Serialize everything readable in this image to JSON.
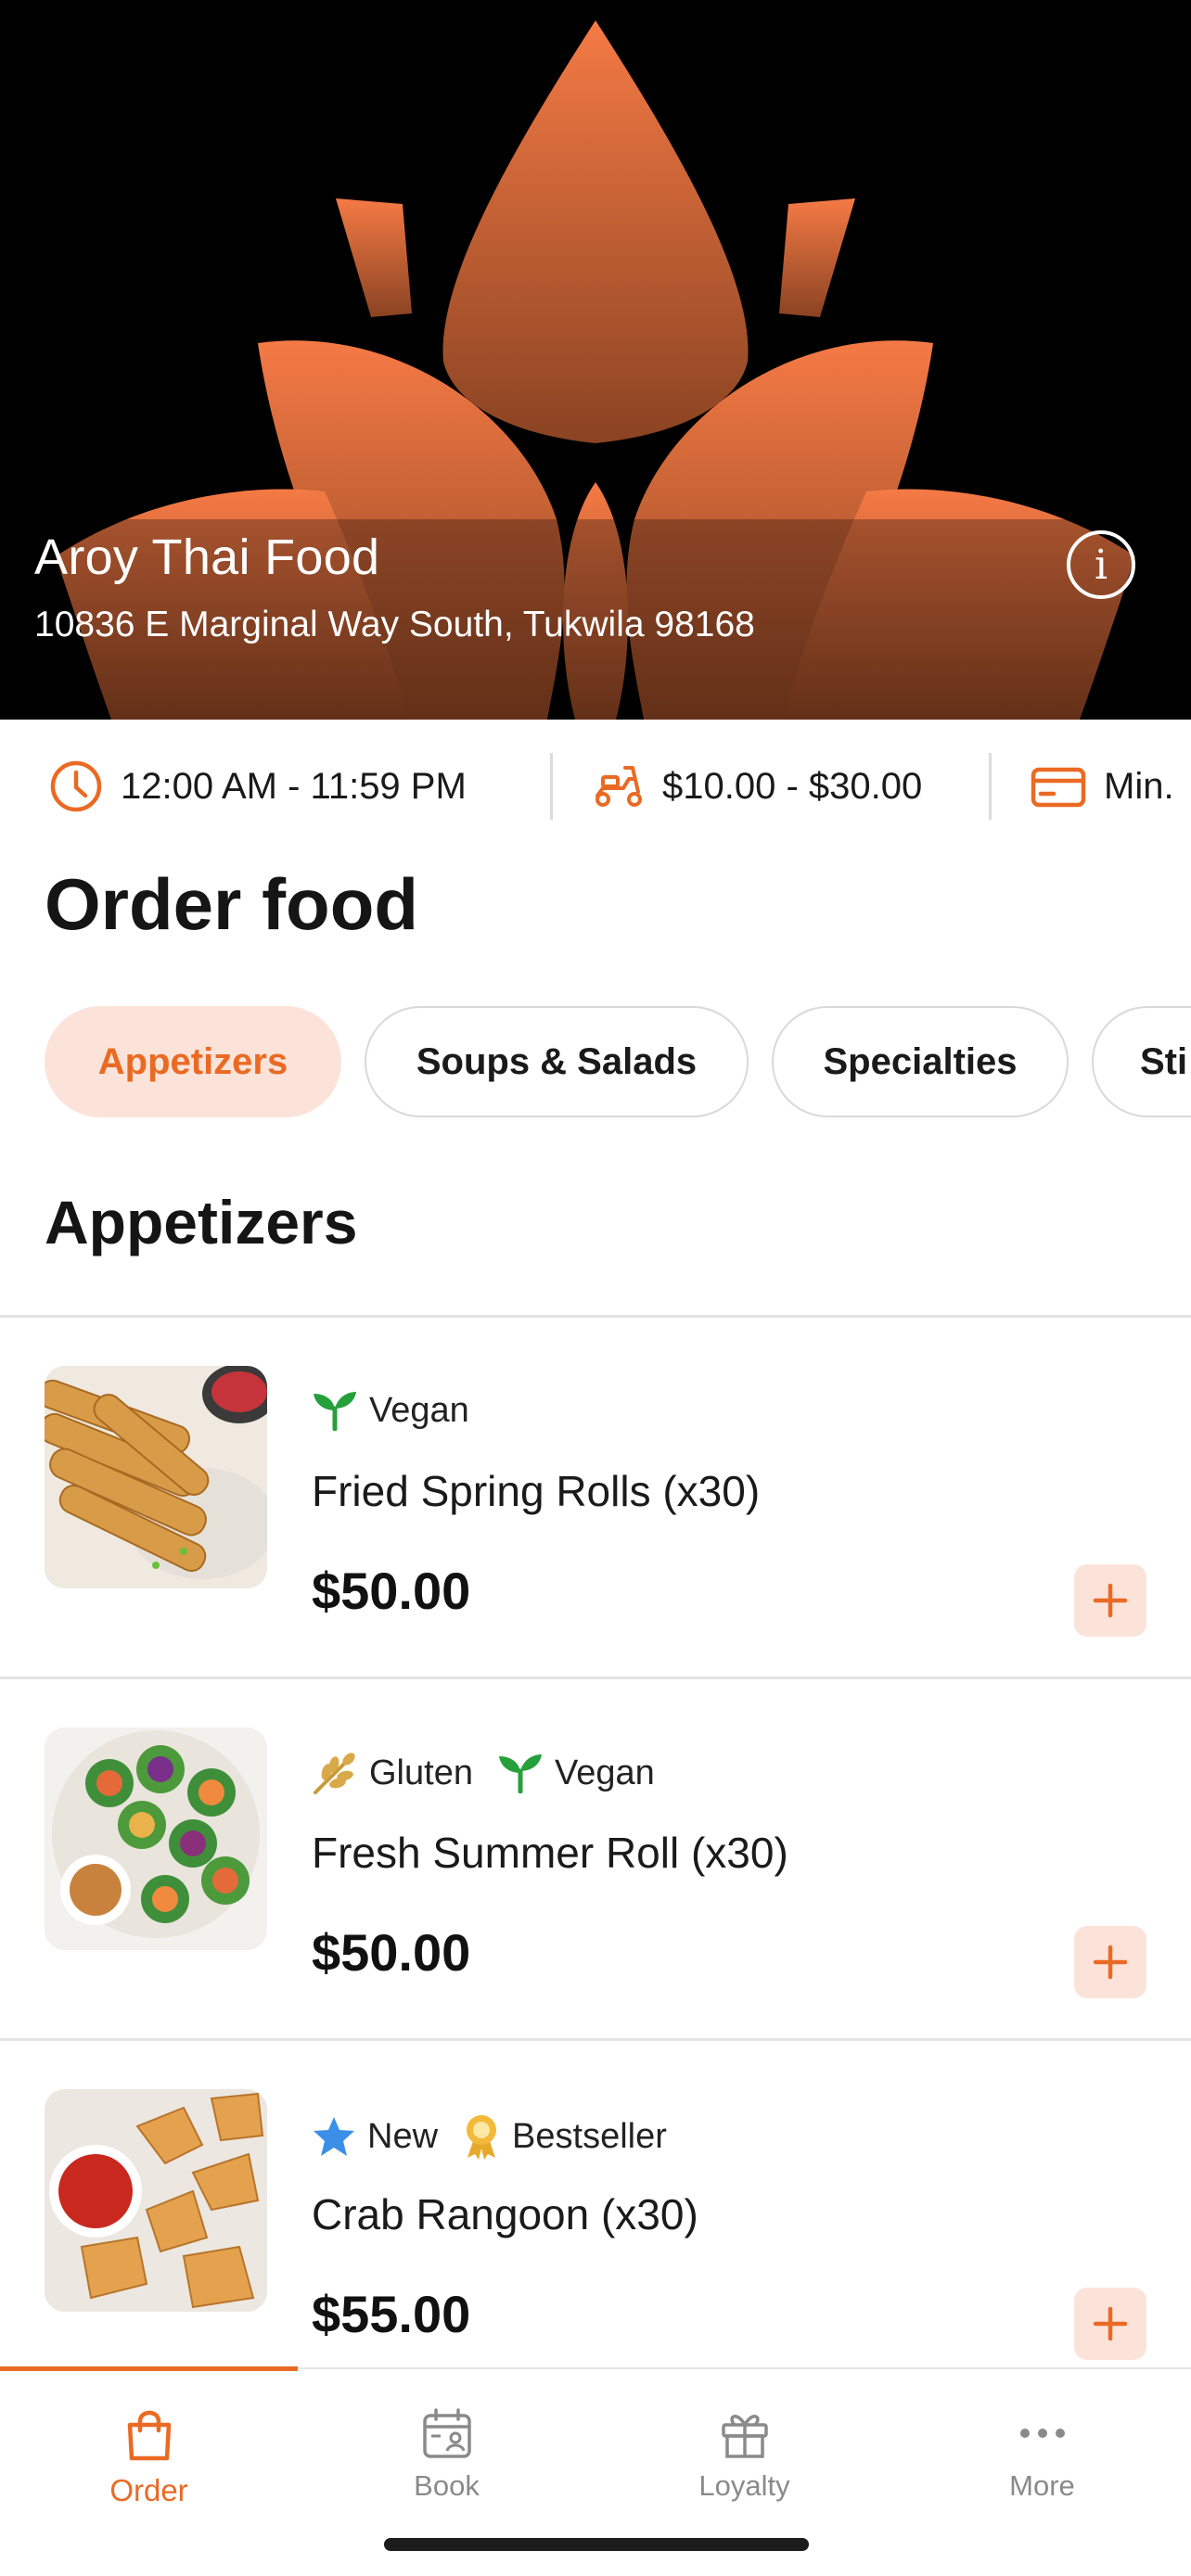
{
  "restaurant": {
    "name": "Aroy Thai Food",
    "address": "10836 E Marginal Way South, Tukwila 98168",
    "info_icon": "info-icon"
  },
  "info_strip": {
    "hours": "12:00 AM - 11:59 PM",
    "delivery_fee": "$10.00 - $30.00",
    "minimum": "Min."
  },
  "order_title": "Order food",
  "categories": [
    {
      "label": "Appetizers",
      "active": true
    },
    {
      "label": "Soups & Salads",
      "active": false
    },
    {
      "label": "Specialties",
      "active": false
    },
    {
      "label": "Sti",
      "active": false
    }
  ],
  "section_title": "Appetizers",
  "items": [
    {
      "name": "Fried Spring Rolls (x30)",
      "price": "$50.00",
      "tags": [
        {
          "icon": "sprout-icon",
          "label": "Vegan"
        }
      ]
    },
    {
      "name": "Fresh Summer Roll (x30)",
      "price": "$50.00",
      "tags": [
        {
          "icon": "wheat-icon",
          "label": "Gluten"
        },
        {
          "icon": "sprout-icon",
          "label": "Vegan"
        }
      ]
    },
    {
      "name": "Crab Rangoon (x30)",
      "price": "$55.00",
      "tags": [
        {
          "icon": "star-icon",
          "label": "New"
        },
        {
          "icon": "award-icon",
          "label": "Bestseller"
        }
      ]
    }
  ],
  "tabs": [
    {
      "label": "Order",
      "icon": "shopping-bag-icon",
      "active": true
    },
    {
      "label": "Book",
      "icon": "calendar-person-icon",
      "active": false
    },
    {
      "label": "Loyalty",
      "icon": "gift-icon",
      "active": false
    },
    {
      "label": "More",
      "icon": "more-dots-icon",
      "active": false
    }
  ],
  "colors": {
    "accent": "#ea6a24",
    "accent_light": "#fce3da",
    "hero_bg": "#000000"
  }
}
